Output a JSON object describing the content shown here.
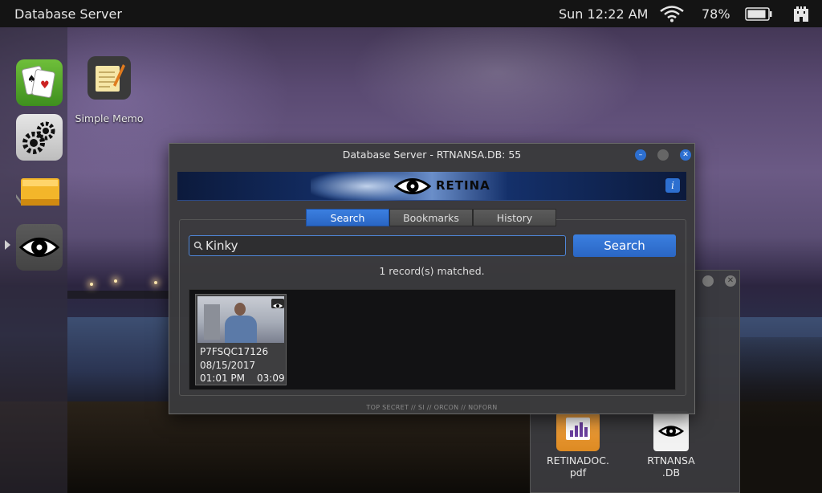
{
  "topbar": {
    "app_title": "Database Server",
    "clock": "Sun 12:22 AM",
    "battery_pct": "78%",
    "icons": [
      "wifi-icon",
      "battery-icon",
      "castle-icon"
    ]
  },
  "dock": {
    "items": [
      {
        "name": "solitaire",
        "icon": "playing-cards-icon"
      },
      {
        "name": "settings",
        "icon": "gears-icon"
      },
      {
        "name": "drive",
        "icon": "hard-drive-icon"
      },
      {
        "name": "retina",
        "icon": "eye-icon"
      }
    ]
  },
  "desktop": {
    "memo_label": "Simple Memo",
    "files": [
      {
        "line1": "RETINADOC.",
        "line2": "pdf"
      },
      {
        "line1": "RTNANSA",
        "line2": ".DB"
      }
    ]
  },
  "window": {
    "title": "Database Server - RTNANSA.DB: 55",
    "brand": "RETINA",
    "info_label": "i",
    "tabs": [
      "Search",
      "Bookmarks",
      "History"
    ],
    "active_tab": "Search",
    "search": {
      "value": "Kinky",
      "button_label": "Search"
    },
    "match_count": "1 record(s) matched.",
    "results": [
      {
        "id": "P7FSQC17126",
        "date": "08/15/2017",
        "time": "01:01 PM",
        "duration": "03:09"
      }
    ],
    "classification": "TOP SECRET // SI // ORCON // NOFORN"
  },
  "colors": {
    "accent": "#2d6fd0",
    "window_bg": "#3a3a3c",
    "topbar_bg": "#141414"
  }
}
